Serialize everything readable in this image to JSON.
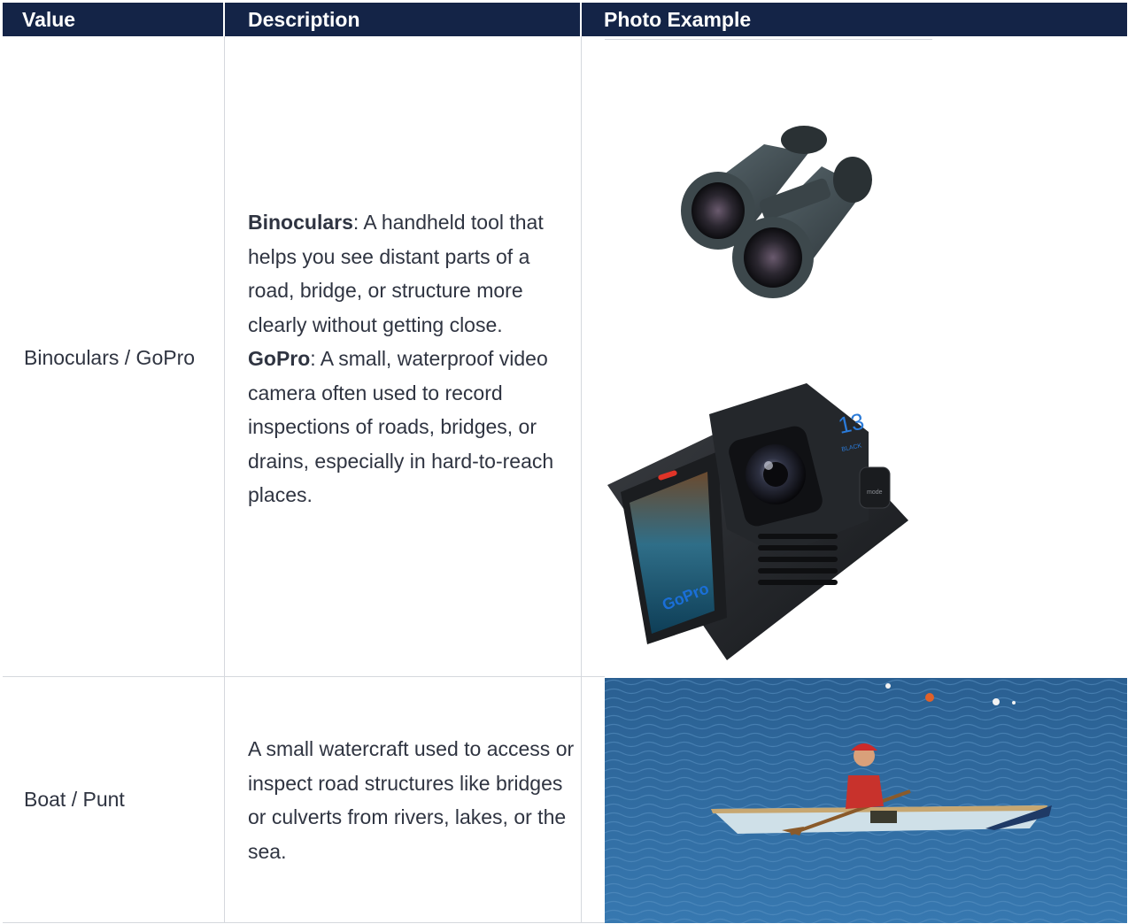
{
  "table": {
    "headers": {
      "value": "Value",
      "description": "Description",
      "photo": "Photo Example"
    },
    "rows": [
      {
        "value": "Binoculars / GoPro",
        "desc_term1": "Binoculars",
        "desc_text1": ": A handheld tool that helps you see distant parts of a road, bridge, or structure more clearly without getting close.",
        "desc_term2": "GoPro",
        "desc_text2": ": A small, waterproof video camera often used to record inspections of roads, bridges, or drains, especially in hard-to-reach places.",
        "photo_gopro_brand": "GoPro",
        "photo_gopro_model": "13",
        "photo_gopro_edition": "BLACK",
        "photo_gopro_mode": "mode"
      },
      {
        "value": "Boat / Punt",
        "description": "A small watercraft used to access or inspect road structures like bridges or culverts from rivers, lakes, or the sea."
      }
    ]
  },
  "colors": {
    "header_bg": "#142447",
    "header_text": "#ffffff",
    "body_text": "#2f3441",
    "grid": "#d5d8dd",
    "water": "#2e6fa4"
  }
}
